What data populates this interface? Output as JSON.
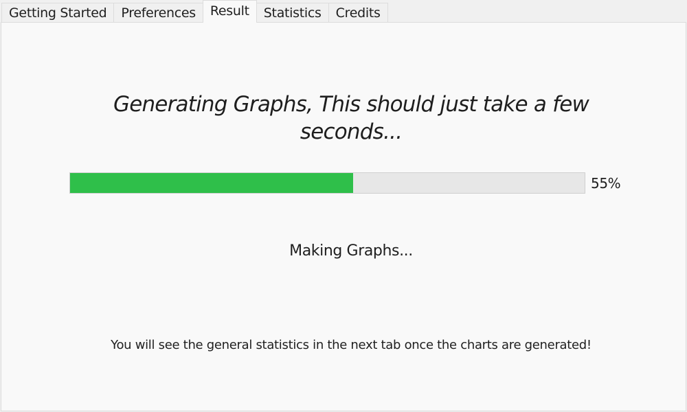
{
  "tabs": [
    {
      "label": "Getting Started",
      "active": false
    },
    {
      "label": "Preferences",
      "active": false
    },
    {
      "label": "Result",
      "active": true
    },
    {
      "label": "Statistics",
      "active": false
    },
    {
      "label": "Credits",
      "active": false
    }
  ],
  "result": {
    "heading": "Generating Graphs, This should just take a few seconds...",
    "progress_value": 0.55,
    "progress_label": "55%",
    "status_text": "Making Graphs...",
    "note_text": "You will see the general statistics in the next tab once the charts are generated!"
  },
  "colors": {
    "progress_fill": "#2fbf4a",
    "progress_track": "#e7e7e7",
    "panel_background": "#f9f9f9"
  }
}
